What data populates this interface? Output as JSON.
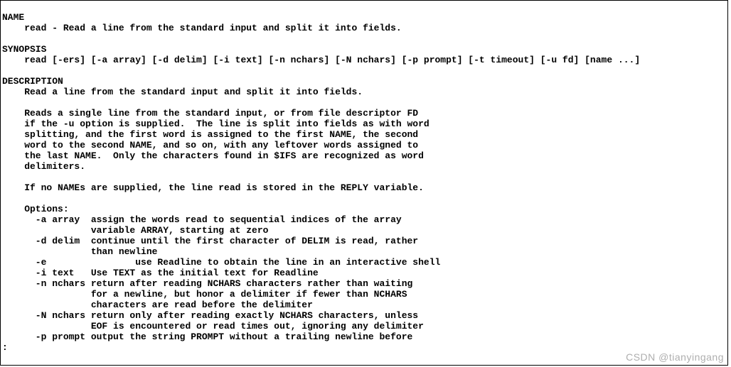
{
  "sections": {
    "name_header": "NAME",
    "name_line": "    read - Read a line from the standard input and split it into fields.",
    "synopsis_header": "SYNOPSIS",
    "synopsis_line": "    read [-ers] [-a array] [-d delim] [-i text] [-n nchars] [-N nchars] [-p prompt] [-t timeout] [-u fd] [name ...]",
    "description_header": "DESCRIPTION",
    "desc_line1": "    Read a line from the standard input and split it into fields.",
    "desc_para2_l1": "    Reads a single line from the standard input, or from file descriptor FD",
    "desc_para2_l2": "    if the -u option is supplied.  The line is split into fields as with word",
    "desc_para2_l3": "    splitting, and the first word is assigned to the first NAME, the second",
    "desc_para2_l4": "    word to the second NAME, and so on, with any leftover words assigned to",
    "desc_para2_l5": "    the last NAME.  Only the characters found in $IFS are recognized as word",
    "desc_para2_l6": "    delimiters.",
    "desc_para3": "    If no NAMEs are supplied, the line read is stored in the REPLY variable.",
    "options_header": "    Options:",
    "opt_a_l1": "      -a array  assign the words read to sequential indices of the array",
    "opt_a_l2": "                variable ARRAY, starting at zero",
    "opt_d_l1": "      -d delim  continue until the first character of DELIM is read, rather",
    "opt_d_l2": "                than newline",
    "opt_e": "      -e                use Readline to obtain the line in an interactive shell",
    "opt_i": "      -i text   Use TEXT as the initial text for Readline",
    "opt_n_l1": "      -n nchars return after reading NCHARS characters rather than waiting",
    "opt_n_l2": "                for a newline, but honor a delimiter if fewer than NCHARS",
    "opt_n_l3": "                characters are read before the delimiter",
    "opt_N_l1": "      -N nchars return only after reading exactly NCHARS characters, unless",
    "opt_N_l2": "                EOF is encountered or read times out, ignoring any delimiter",
    "opt_p": "      -p prompt output the string PROMPT without a trailing newline before",
    "prompt": ":"
  },
  "watermark": "CSDN @tianyingang"
}
